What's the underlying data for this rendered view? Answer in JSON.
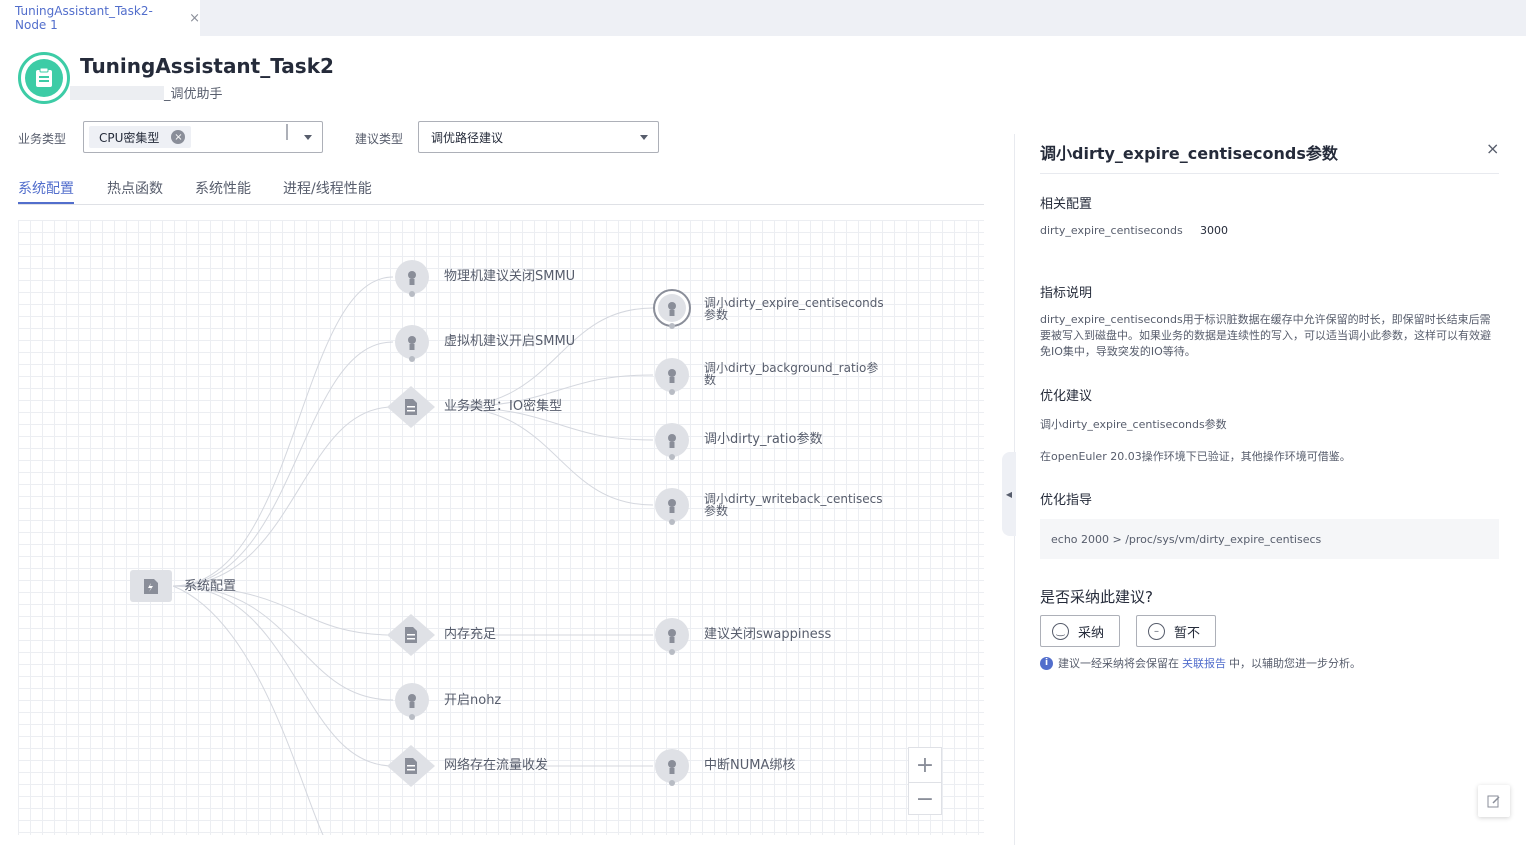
{
  "tab": {
    "label": "TuningAssistant_Task2-Node 1",
    "close": "×"
  },
  "header": {
    "title": "TuningAssistant_Task2",
    "subtitle": "_调优助手"
  },
  "filters": {
    "business_label": "业务类型",
    "business_tag": "CPU密集型",
    "advice_label": "建议类型",
    "advice_value": "调优路径建议"
  },
  "nav_tabs": [
    "系统配置",
    "热点函数",
    "系统性能",
    "进程/线程性能"
  ],
  "graph": {
    "root": "系统配置",
    "nodes": [
      "物理机建议关闭SMMU",
      "虚拟机建议开启SMMU",
      "业务类型：IO密集型",
      "内存充足",
      "开启nohz",
      "网络存在流量收发",
      "调小dirty_expire_centiseconds参数",
      "调小dirty_background_ratio参数",
      "调小dirty_ratio参数",
      "调小dirty_writeback_centisecs参数",
      "建议关闭swappiness",
      "中断NUMA绑核"
    ]
  },
  "zoom": {
    "in": "+",
    "out": "−"
  },
  "panel": {
    "title": "调小dirty_expire_centiseconds参数",
    "close": "×",
    "config_heading": "相关配置",
    "config_key": "dirty_expire_centiseconds",
    "config_value": "3000",
    "metric_heading": "指标说明",
    "metric_desc": "dirty_expire_centiseconds用于标识脏数据在缓存中允许保留的时长，即保留时长结束后需要被写入到磁盘中。如果业务的数据是连续性的写入，可以适当调小此参数，这样可以有效避免IO集中，导致突发的IO等待。",
    "opt_heading": "优化建议",
    "opt_text": "调小dirty_expire_centiseconds参数",
    "opt_env": "在openEuler 20.03操作环境下已验证，其他操作环境可借鉴。",
    "guide_heading": "优化指导",
    "guide_cmd": "echo 2000 > /proc/sys/vm/dirty_expire_centisecs",
    "question": "是否采纳此建议?",
    "accept": "采纳",
    "reject": "暂不",
    "note_pre": "建议一经采纳将会保留在",
    "note_link": "关联报告",
    "note_post": "中，以辅助您进一步分析。"
  }
}
